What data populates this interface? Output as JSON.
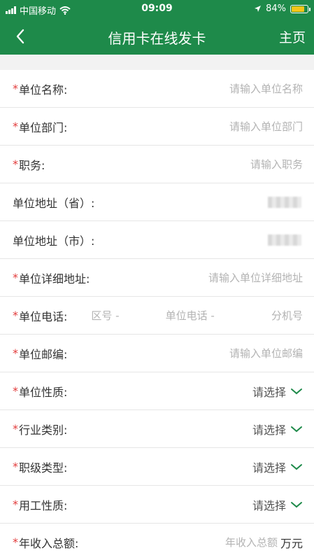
{
  "status_bar": {
    "carrier": "中国移动",
    "time": "09:09",
    "battery": "84%",
    "battery_level": 0.84,
    "icons": [
      "signal-icon",
      "wifi-icon",
      "location-icon",
      "battery-icon"
    ]
  },
  "nav": {
    "title": "信用卡在线发卡",
    "home": "主页",
    "back_icon": "chevron-left-icon"
  },
  "form": {
    "required_mark": "*",
    "unit_name": {
      "label": "单位名称:",
      "placeholder": "请输入单位名称"
    },
    "department": {
      "label": "单位部门:",
      "placeholder": "请输入单位部门"
    },
    "position": {
      "label": "职务:",
      "placeholder": "请输入职务"
    },
    "province": {
      "label": "单位地址（省）:"
    },
    "city": {
      "label": "单位地址（市）:"
    },
    "detail_address": {
      "label": "单位详细地址:",
      "placeholder": "请输入单位详细地址"
    },
    "phone": {
      "label": "单位电话:",
      "area_code": "区号 -",
      "number": "单位电话 -",
      "extension": "分机号"
    },
    "postcode": {
      "label": "单位邮编:",
      "placeholder": "请输入单位邮编"
    },
    "nature": {
      "label": "单位性质:",
      "value": "请选择"
    },
    "industry": {
      "label": "行业类别:",
      "value": "请选择"
    },
    "job_level": {
      "label": "职级类型:",
      "value": "请选择"
    },
    "employment": {
      "label": "用工性质:",
      "value": "请选择"
    },
    "annual_income": {
      "label": "年收入总额:",
      "placeholder": "年收入总额",
      "unit": "万元"
    }
  },
  "colors": {
    "primary": "#1e8a4a",
    "required": "#e23c3c",
    "placeholder": "#b3b3b3",
    "chevron": "#1e8a4a"
  }
}
